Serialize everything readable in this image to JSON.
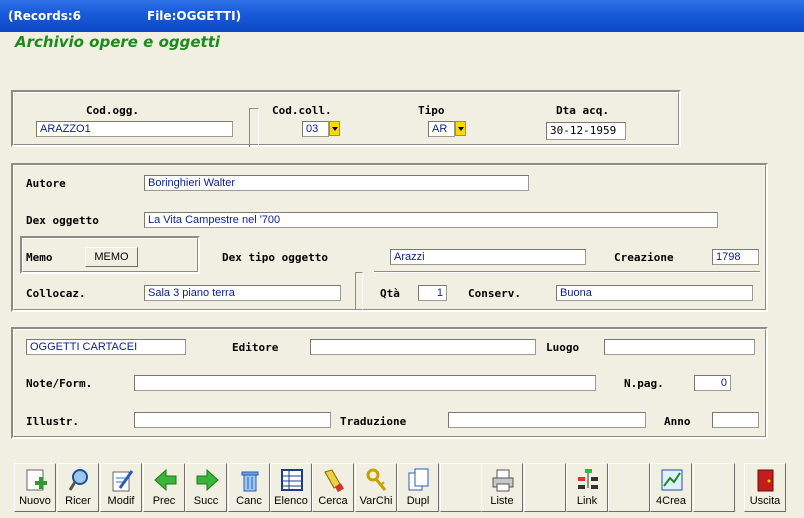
{
  "title_bar": {
    "records": "(Records:6",
    "file": "File:OGGETTI)"
  },
  "heading": "Archivio opere e oggetti",
  "top_group": {
    "cod_ogg_label": "Cod.ogg.",
    "cod_ogg_value": "ARAZZO1",
    "cod_coll_label": "Cod.coll.",
    "cod_coll_value": "03",
    "tipo_label": "Tipo",
    "tipo_value": "AR",
    "dta_acq_label": "Dta acq.",
    "dta_acq_value": "30-12-1959"
  },
  "main_group": {
    "autore_label": "Autore",
    "autore_value": "Boringhieri Walter",
    "dex_oggetto_label": "Dex oggetto",
    "dex_oggetto_value": "La Vita Campestre nel '700",
    "memo_label": "Memo",
    "memo_button": "MEMO",
    "dex_tipo_label": "Dex tipo oggetto",
    "dex_tipo_value": "Arazzi",
    "creazione_label": "Creazione",
    "creazione_value": "1798",
    "collocaz_label": "Collocaz.",
    "collocaz_value": "Sala 3 piano terra",
    "qta_label": "Qtà",
    "qta_value": "1",
    "conserv_label": "Conserv.",
    "conserv_value": "Buona"
  },
  "bottom_group": {
    "category_value": "OGGETTI CARTACEI",
    "editore_label": "Editore",
    "editore_value": "",
    "luogo_label": "Luogo",
    "luogo_value": "",
    "note_label": "Note/Form.",
    "note_value": "",
    "npag_label": "N.pag.",
    "npag_value": "0",
    "illustr_label": "Illustr.",
    "illustr_value": "",
    "traduzione_label": "Traduzione",
    "traduzione_value": "",
    "anno_label": "Anno",
    "anno_value": ""
  },
  "toolbar": {
    "nuovo": "Nuovo",
    "ricer": "Ricer",
    "modif": "Modif",
    "prec": "Prec",
    "succ": "Succ",
    "canc": "Canc",
    "elenco": "Elenco",
    "cerca": "Cerca",
    "varchi": "VarChi",
    "dupl": "Dupl",
    "liste": "Liste",
    "link": "Link",
    "crea4": "4Crea",
    "uscita": "Uscita"
  },
  "colors": {
    "heading": "#1d8a1d",
    "titlebar": "#0c47c5",
    "field_text": "#0a1e8c",
    "dropdown": "#ffd800"
  }
}
